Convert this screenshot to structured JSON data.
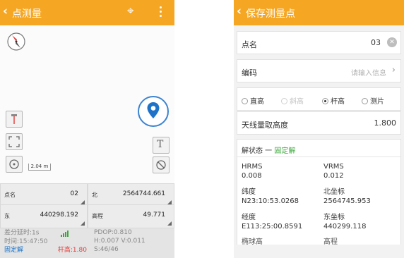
{
  "left": {
    "title": "点测量",
    "map": {
      "scale_label": "2.04 m",
      "compass_icon": "compass-icon",
      "crosshair_icon": "crosshair-icon",
      "location_icon": "location-pin-icon",
      "text_tool_label": "T"
    },
    "fields": [
      {
        "label": "点名",
        "value": "02"
      },
      {
        "label": "北",
        "value": "2564744.661"
      },
      {
        "label": "东",
        "value": "440298.192"
      },
      {
        "label": "高程",
        "value": "49.771"
      }
    ],
    "status": {
      "diff_delay": "差分延时:1s",
      "time": "时间:15:47:50",
      "solution": "固定解",
      "pole_height": "杆高:1.80",
      "pdop": "PDOP:0.810",
      "hv": "H:0.007  V:0.011",
      "sats": "S:46/46"
    }
  },
  "right": {
    "title": "保存测量点",
    "point_name": {
      "label": "点名",
      "value": "03"
    },
    "code": {
      "label": "编码",
      "placeholder": "请输入信息"
    },
    "height_modes": [
      {
        "label": "直高",
        "checked": false,
        "disabled": false
      },
      {
        "label": "斜高",
        "checked": false,
        "disabled": true
      },
      {
        "label": "杆高",
        "checked": true,
        "disabled": false
      },
      {
        "label": "测片",
        "checked": false,
        "disabled": false
      }
    ],
    "antenna": {
      "label": "天线量取高度",
      "value": "1.800"
    },
    "solution": {
      "label": "解状态 一",
      "state": "固定解",
      "hrms_label": "HRMS",
      "hrms": "0.008",
      "vrms_label": "VRMS",
      "vrms": "0.012",
      "lat_label": "纬度",
      "lat": "N23:10:53.0268",
      "north_label": "北坐标",
      "north": "2564745.953",
      "lon_label": "经度",
      "lon": "E113:25:00.8591",
      "east_label": "东坐标",
      "east": "440299.118",
      "cut_left": "椭球高",
      "cut_right": "高程"
    }
  },
  "colors": {
    "appbar": "#f5a623",
    "fixed": "#3ca83c",
    "pole": "#e53935",
    "accent_blue": "#1a73c9"
  }
}
